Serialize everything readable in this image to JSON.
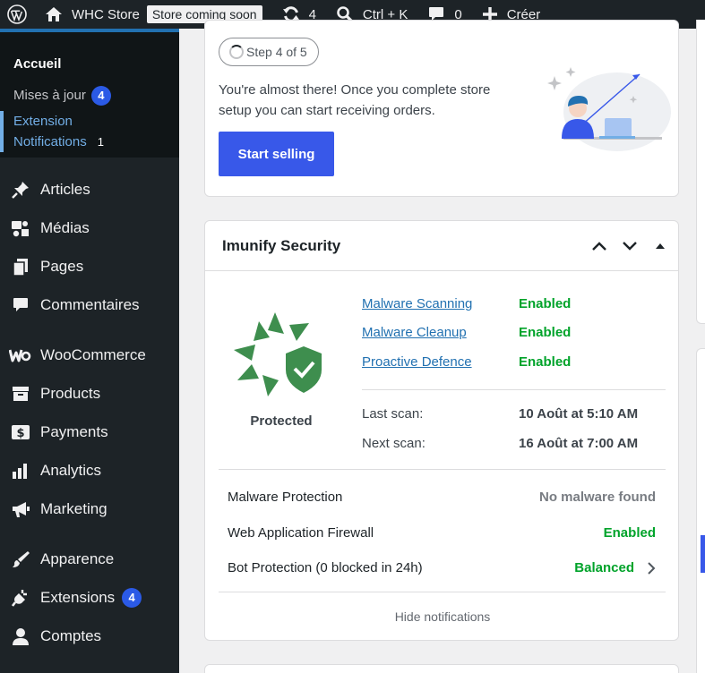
{
  "adminbar": {
    "site_name": "WHC Store",
    "store_status": "Store coming soon",
    "updates_count": "4",
    "search_shortcut": "Ctrl + K",
    "comments_count": "0",
    "create_label": "Créer"
  },
  "sidebar": {
    "submenu": {
      "home": "Accueil",
      "updates": "Mises à jour",
      "updates_badge": "4",
      "ext_line1": "Extension",
      "ext_line2": "Notifications",
      "ext_count": "1"
    },
    "items": [
      {
        "label": "Articles",
        "icon": "pin-icon"
      },
      {
        "label": "Médias",
        "icon": "media-icon"
      },
      {
        "label": "Pages",
        "icon": "pages-icon"
      },
      {
        "label": "Commentaires",
        "icon": "comment-icon"
      },
      {
        "label": "WooCommerce",
        "icon": "woo-icon"
      },
      {
        "label": "Products",
        "icon": "archive-icon"
      },
      {
        "label": "Payments",
        "icon": "dollar-icon"
      },
      {
        "label": "Analytics",
        "icon": "bar-chart-icon"
      },
      {
        "label": "Marketing",
        "icon": "megaphone-icon"
      },
      {
        "label": "Apparence",
        "icon": "paintbrush-icon"
      },
      {
        "label": "Extensions",
        "icon": "plug-icon",
        "badge": "4"
      },
      {
        "label": "Comptes",
        "icon": "user-icon"
      }
    ]
  },
  "step_card": {
    "step_label": "Step 4 of 5",
    "message": "You're almost there! Once you complete store setup you can start receiving orders.",
    "cta": "Start selling"
  },
  "security": {
    "title": "Imunify Security",
    "status": "Protected",
    "features": [
      {
        "name": "Malware Scanning",
        "status": "Enabled"
      },
      {
        "name": "Malware Cleanup",
        "status": "Enabled"
      },
      {
        "name": "Proactive Defence",
        "status": "Enabled"
      }
    ],
    "last_scan_label": "Last scan:",
    "last_scan_value": "10 Août at 5:10 AM",
    "next_scan_label": "Next scan:",
    "next_scan_value": "16 Août at 7:00 AM",
    "protections": [
      {
        "label": "Malware Protection",
        "value": "No malware found"
      },
      {
        "label": "Web Application Firewall",
        "value": "Enabled"
      },
      {
        "label": "Bot Protection (0 blocked in 24h)",
        "value": "Balanced"
      }
    ],
    "hide_label": "Hide notifications"
  },
  "colors": {
    "accent": "#3858e9",
    "enabled_green": "#00a32a",
    "admin_dark": "#1d2327",
    "shield_green": "#3e8e4e"
  }
}
